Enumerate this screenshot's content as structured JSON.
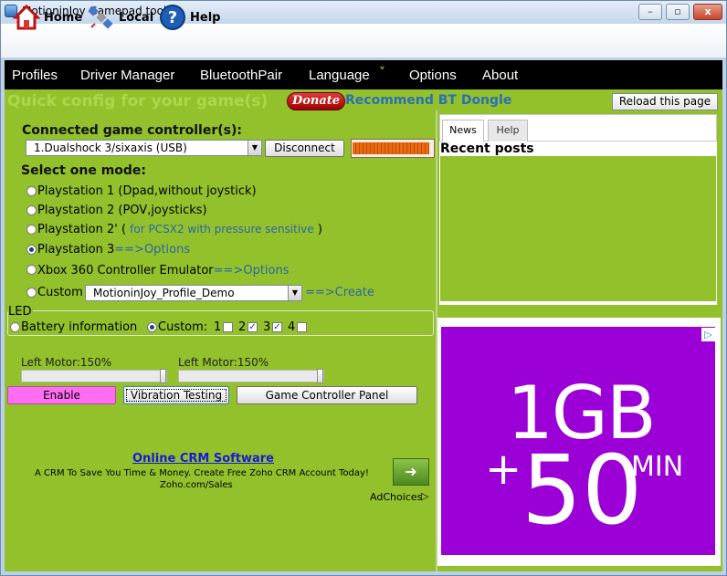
{
  "window": {
    "title": "MotioninJoy Gamepad tool",
    "min": "–",
    "max": "▫",
    "close": "x"
  },
  "toolbar": {
    "home": "Home",
    "local": "Local",
    "help": "Help"
  },
  "menu": [
    "Profiles",
    "Driver Manager",
    "BluetoothPair",
    "Language",
    "Options",
    "About"
  ],
  "menu_language_caret": "˅",
  "header": {
    "quick_config": "Quick config for your game(s)",
    "donate": "Donate",
    "recommend": "Recommend BT Dongle",
    "reload": "Reload this page"
  },
  "controller": {
    "label": "Connected game controller(s):",
    "selected": "1.Dualshock 3/sixaxis (USB)",
    "disconnect": "Disconnect",
    "battery_fraction": 0.95
  },
  "mode": {
    "label": "Select one mode:",
    "ps1": "Playstation 1 (Dpad,without joystick)",
    "ps2": "Playstation 2 (POV,joysticks)",
    "ps2p_a": "Playstation 2' (",
    "ps2p_b": "for PCSX2 with pressure sensitive",
    "ps2p_c": ")",
    "ps3": "Playstation 3",
    "ps3_opt": "==>Options",
    "xbox": "Xbox 360 Controller Emulator",
    "xbox_opt": "==>Options",
    "custom": "Custom",
    "custom_profile": "MotioninJoy_Profile_Demo",
    "custom_create": "==>Create"
  },
  "led": {
    "label": "LED",
    "battery": "Battery information",
    "custom": "Custom:",
    "n1": "1",
    "n2": "2",
    "n3": "3",
    "n4": "4",
    "checks": [
      "",
      "✓",
      "✓",
      ""
    ]
  },
  "motors": {
    "left1": "Left Motor:150%",
    "left2": "Left Motor:150%",
    "level1": 1.0,
    "level2": 1.0
  },
  "buttons": {
    "enable": "Enable",
    "vibration": "Vibration Testing",
    "panel": "Game Controller Panel"
  },
  "ad_left": {
    "title": "Online CRM Software",
    "body": "A CRM To Save You Time & Money. Create Free Zoho CRM Account Today!",
    "domain": "Zoho.com/Sales",
    "adchoices": "AdChoices",
    "arrow": "➜"
  },
  "news": {
    "tab_news": "News",
    "tab_help": "Help",
    "heading": "Recent posts"
  },
  "ad_right": {
    "line1": "1GB",
    "line2": "+",
    "line3": "50",
    "line4": "MIN",
    "adchoice_icon": "▷"
  }
}
